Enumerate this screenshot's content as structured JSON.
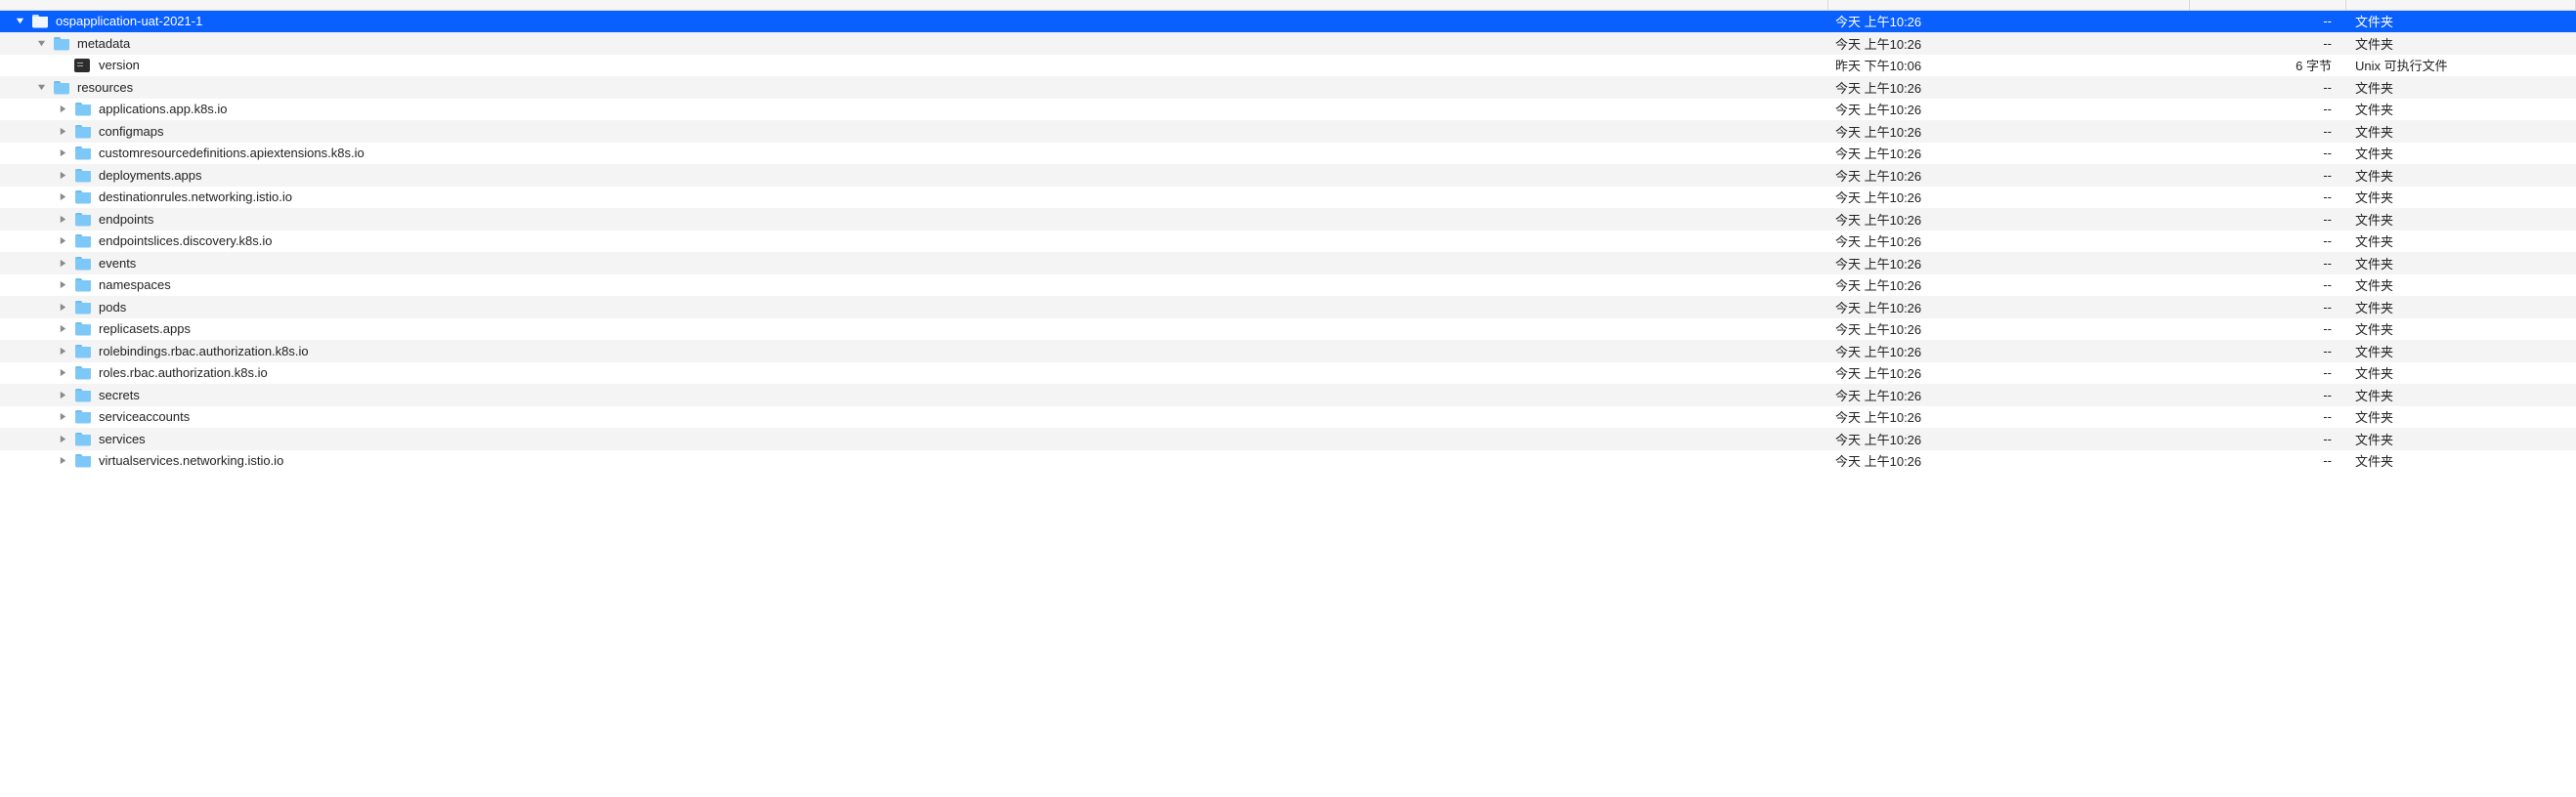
{
  "rows": [
    {
      "indent": 0,
      "expanded": true,
      "icon": "folder",
      "name": "ospapplication-uat-2021-1",
      "date": "今天 上午10:26",
      "size": "--",
      "kind": "文件夹",
      "selected": true
    },
    {
      "indent": 1,
      "expanded": true,
      "icon": "folder",
      "name": "metadata",
      "date": "今天 上午10:26",
      "size": "--",
      "kind": "文件夹",
      "selected": false
    },
    {
      "indent": 2,
      "expanded": null,
      "icon": "exec",
      "name": "version",
      "date": "昨天 下午10:06",
      "size": "6 字节",
      "kind": "Unix 可执行文件",
      "selected": false
    },
    {
      "indent": 1,
      "expanded": true,
      "icon": "folder",
      "name": "resources",
      "date": "今天 上午10:26",
      "size": "--",
      "kind": "文件夹",
      "selected": false
    },
    {
      "indent": 2,
      "expanded": false,
      "icon": "folder",
      "name": "applications.app.k8s.io",
      "date": "今天 上午10:26",
      "size": "--",
      "kind": "文件夹",
      "selected": false
    },
    {
      "indent": 2,
      "expanded": false,
      "icon": "folder",
      "name": "configmaps",
      "date": "今天 上午10:26",
      "size": "--",
      "kind": "文件夹",
      "selected": false
    },
    {
      "indent": 2,
      "expanded": false,
      "icon": "folder",
      "name": "customresourcedefinitions.apiextensions.k8s.io",
      "date": "今天 上午10:26",
      "size": "--",
      "kind": "文件夹",
      "selected": false
    },
    {
      "indent": 2,
      "expanded": false,
      "icon": "folder",
      "name": "deployments.apps",
      "date": "今天 上午10:26",
      "size": "--",
      "kind": "文件夹",
      "selected": false
    },
    {
      "indent": 2,
      "expanded": false,
      "icon": "folder",
      "name": "destinationrules.networking.istio.io",
      "date": "今天 上午10:26",
      "size": "--",
      "kind": "文件夹",
      "selected": false
    },
    {
      "indent": 2,
      "expanded": false,
      "icon": "folder",
      "name": "endpoints",
      "date": "今天 上午10:26",
      "size": "--",
      "kind": "文件夹",
      "selected": false
    },
    {
      "indent": 2,
      "expanded": false,
      "icon": "folder",
      "name": "endpointslices.discovery.k8s.io",
      "date": "今天 上午10:26",
      "size": "--",
      "kind": "文件夹",
      "selected": false
    },
    {
      "indent": 2,
      "expanded": false,
      "icon": "folder",
      "name": "events",
      "date": "今天 上午10:26",
      "size": "--",
      "kind": "文件夹",
      "selected": false
    },
    {
      "indent": 2,
      "expanded": false,
      "icon": "folder",
      "name": "namespaces",
      "date": "今天 上午10:26",
      "size": "--",
      "kind": "文件夹",
      "selected": false
    },
    {
      "indent": 2,
      "expanded": false,
      "icon": "folder",
      "name": "pods",
      "date": "今天 上午10:26",
      "size": "--",
      "kind": "文件夹",
      "selected": false
    },
    {
      "indent": 2,
      "expanded": false,
      "icon": "folder",
      "name": "replicasets.apps",
      "date": "今天 上午10:26",
      "size": "--",
      "kind": "文件夹",
      "selected": false
    },
    {
      "indent": 2,
      "expanded": false,
      "icon": "folder",
      "name": "rolebindings.rbac.authorization.k8s.io",
      "date": "今天 上午10:26",
      "size": "--",
      "kind": "文件夹",
      "selected": false
    },
    {
      "indent": 2,
      "expanded": false,
      "icon": "folder",
      "name": "roles.rbac.authorization.k8s.io",
      "date": "今天 上午10:26",
      "size": "--",
      "kind": "文件夹",
      "selected": false
    },
    {
      "indent": 2,
      "expanded": false,
      "icon": "folder",
      "name": "secrets",
      "date": "今天 上午10:26",
      "size": "--",
      "kind": "文件夹",
      "selected": false
    },
    {
      "indent": 2,
      "expanded": false,
      "icon": "folder",
      "name": "serviceaccounts",
      "date": "今天 上午10:26",
      "size": "--",
      "kind": "文件夹",
      "selected": false
    },
    {
      "indent": 2,
      "expanded": false,
      "icon": "folder",
      "name": "services",
      "date": "今天 上午10:26",
      "size": "--",
      "kind": "文件夹",
      "selected": false
    },
    {
      "indent": 2,
      "expanded": false,
      "icon": "folder",
      "name": "virtualservices.networking.istio.io",
      "date": "今天 上午10:26",
      "size": "--",
      "kind": "文件夹",
      "selected": false
    }
  ]
}
